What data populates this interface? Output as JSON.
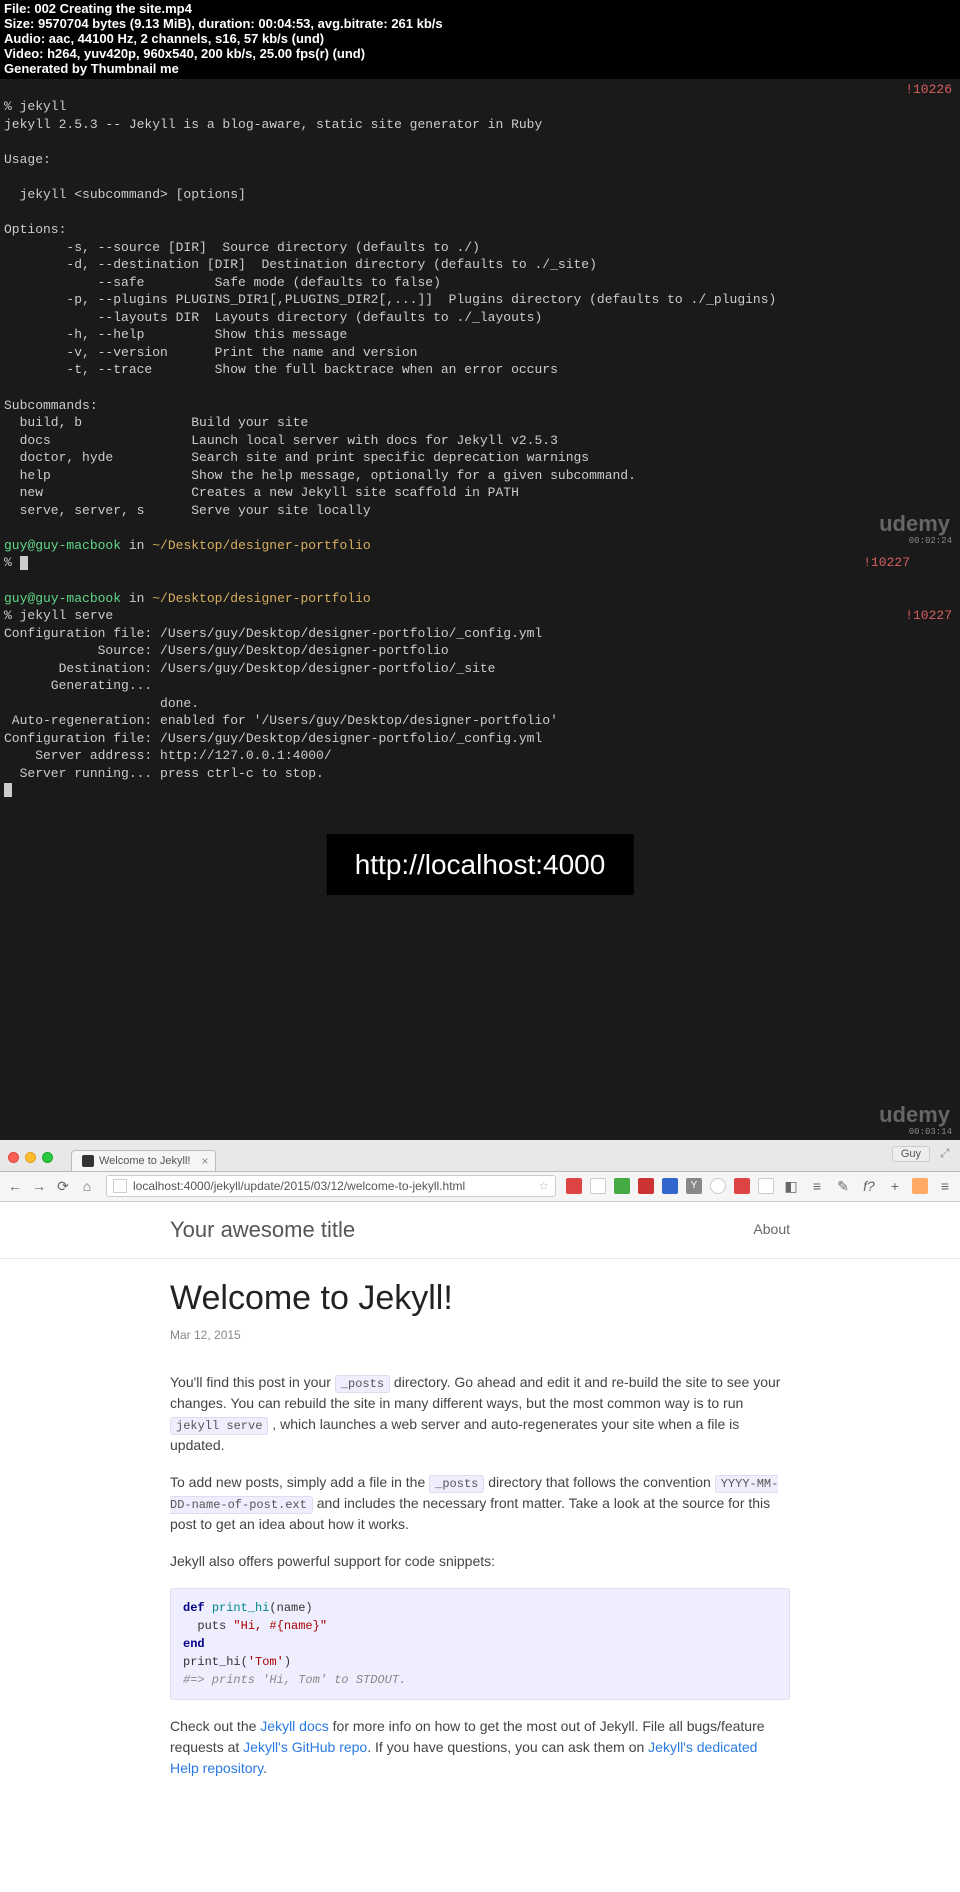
{
  "header": {
    "l1_a": "File: ",
    "l1_b": "002 Creating the site.mp4",
    "l2_a": "Size: ",
    "l2_b": "9570704 ",
    "l2_c": "bytes (",
    "l2_d": "9.13 ",
    "l2_e": "MiB), ",
    "l2_f": "duration: ",
    "l2_g": "00:04:53, ",
    "l2_h": "avg.bitrate: ",
    "l2_i": "261 ",
    "l2_j": "kb/s",
    "l3_a": "Audio: ",
    "l3_b": "aac, 44100 ",
    "l3_c": "Hz, ",
    "l3_d": "2 ",
    "l3_e": "channels, ",
    "l3_f": "s16, 57 ",
    "l3_g": "kb/s (und)",
    "l4_a": "Video: ",
    "l4_b": "h264, yuv420p, 960x540, 200 ",
    "l4_c": "kb/s, ",
    "l4_d": "25.00 ",
    "l4_e": "fps(r) (und)",
    "l5": "Generated by Thumbnail me"
  },
  "terminal": {
    "top_right": "!10226",
    "line_prompt": "% jekyll",
    "line1": "jekyll 2.5.3 -- Jekyll is a blog-aware, static site generator in Ruby",
    "usage_h": "Usage:",
    "usage": "  jekyll <subcommand> [options]",
    "opt_h": "Options:",
    "opt1": "        -s, --source [DIR]  Source directory (defaults to ./)",
    "opt2": "        -d, --destination [DIR]  Destination directory (defaults to ./_site)",
    "opt3": "            --safe         Safe mode (defaults to false)",
    "opt4": "        -p, --plugins PLUGINS_DIR1[,PLUGINS_DIR2[,...]]  Plugins directory (defaults to ./_plugins)",
    "opt5": "            --layouts DIR  Layouts directory (defaults to ./_layouts)",
    "opt6": "        -h, --help         Show this message",
    "opt7": "        -v, --version      Print the name and version",
    "opt8": "        -t, --trace        Show the full backtrace when an error occurs",
    "sub_h": "Subcommands:",
    "sub1": "  build, b              Build your site",
    "sub2": "  docs                  Launch local server with docs for Jekyll v2.5.3",
    "sub3": "  doctor, hyde          Search site and print specific deprecation warnings",
    "sub4": "  help                  Show the help message, optionally for a given subcommand.",
    "sub5": "  new                   Creates a new Jekyll site scaffold in PATH",
    "sub6": "  serve, server, s      Serve your site locally",
    "prompt_user": "guy@guy-macbook",
    "prompt_in": " in ",
    "prompt_path": "~/Desktop/designer-portfolio",
    "prompt_sym": "% ",
    "right2": "!10227",
    "cmd": "jekyll serve",
    "s1": "Configuration file: /Users/guy/Desktop/designer-portfolio/_config.yml",
    "s2": "            Source: /Users/guy/Desktop/designer-portfolio",
    "s3": "       Destination: /Users/guy/Desktop/designer-portfolio/_site",
    "s4": "      Generating...",
    "s5": "                    done.",
    "s6": " Auto-regeneration: enabled for '/Users/guy/Desktop/designer-portfolio'",
    "s7": "Configuration file: /Users/guy/Desktop/designer-portfolio/_config.yml",
    "s8": "    Server address: http://127.0.0.1:4000/",
    "s9": "  Server running... press ctrl-c to stop.",
    "watermark": "udemy",
    "ts1": "00:02:24",
    "ts2": "00:03:14",
    "overlay": "http://localhost:4000"
  },
  "browser": {
    "tab_title": "Welcome to Jekyll!",
    "username": "Guy",
    "url": "localhost:4000/jekyll/update/2015/03/12/welcome-to-jekyll.html"
  },
  "page": {
    "site_title": "Your awesome title",
    "nav_about": "About",
    "post_title": "Welcome to Jekyll!",
    "post_date": "Mar 12, 2015",
    "p1_a": "You'll find this post in your ",
    "p1_code1": "_posts",
    "p1_b": " directory. Go ahead and edit it and re-build the site to see your changes. You can rebuild the site in many different ways, but the most common way is to run ",
    "p1_code2": "jekyll serve",
    "p1_c": " , which launches a web server and auto-regenerates your site when a file is updated.",
    "p2_a": "To add new posts, simply add a file in the ",
    "p2_code1": "_posts",
    "p2_b": " directory that follows the convention ",
    "p2_code2": "YYYY-MM-DD-name-of-post.ext",
    "p2_c": " and includes the necessary front matter. Take a look at the source for this post to get an idea about how it works.",
    "p3": "Jekyll also offers powerful support for code snippets:",
    "code": {
      "l1_a": "def ",
      "l1_b": "print_hi",
      "l1_c": "(name)",
      "l2_a": "  puts ",
      "l2_b": "\"Hi, #{name}\"",
      "l3": "end",
      "l4_a": "print_hi(",
      "l4_b": "'Tom'",
      "l4_c": ")",
      "l5": "#=> prints 'Hi, Tom' to STDOUT."
    },
    "p4_a": "Check out the ",
    "p4_link1": "Jekyll docs",
    "p4_b": " for more info on how to get the most out of Jekyll. File all bugs/feature requests at ",
    "p4_link2": "Jekyll's GitHub repo",
    "p4_c": ". If you have questions, you can ask them on ",
    "p4_link3": "Jekyll's dedicated Help repository",
    "p4_d": "."
  }
}
